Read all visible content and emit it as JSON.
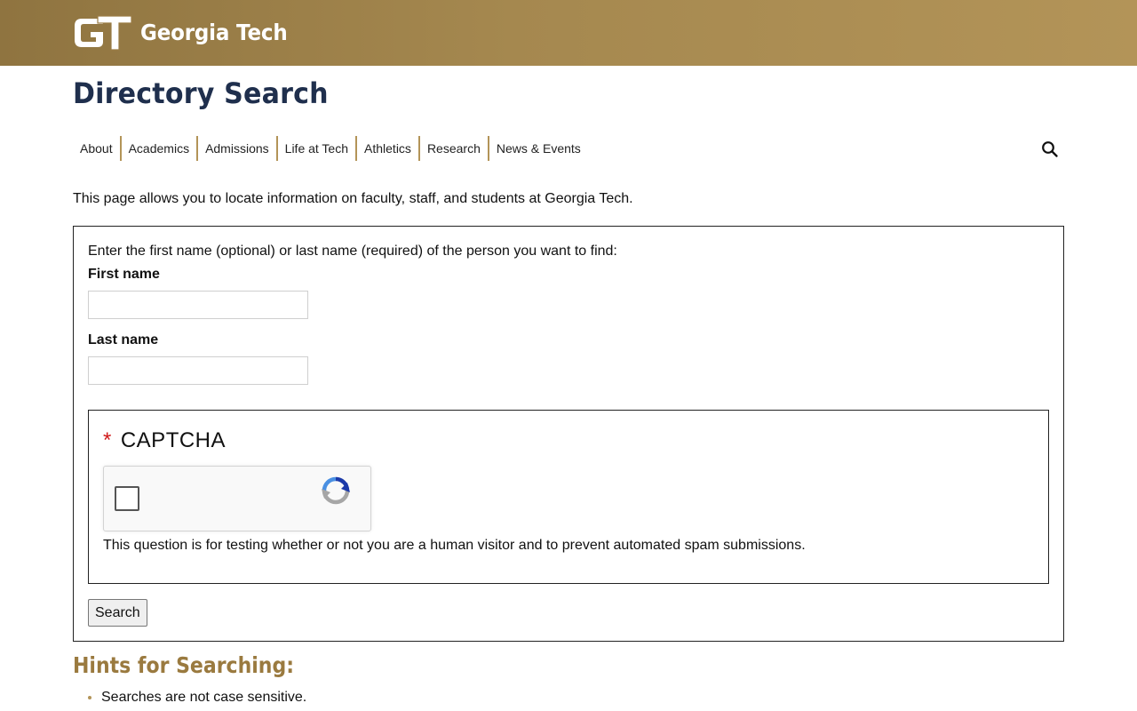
{
  "header": {
    "logo_text": "Georgia Tech",
    "logo_mark_letters": "GT",
    "colors": {
      "band_start": "#8f7440",
      "band_end": "#b39458"
    }
  },
  "page": {
    "title": "Directory Search",
    "title_color": "#1f2f4d"
  },
  "nav": {
    "items": [
      "About",
      "Academics",
      "Admissions",
      "Life at Tech",
      "Athletics",
      "Research",
      "News & Events"
    ],
    "search_icon": "search-icon",
    "separator_color": "#b39458"
  },
  "intro_text": "This page allows you to locate information on faculty, staff, and students at Georgia Tech.",
  "form": {
    "instructions": "Enter the first name (optional) or last name (required) of the person you want to find:",
    "first_name_label": "First name",
    "first_name_value": "",
    "last_name_label": "Last name",
    "last_name_value": "",
    "captcha": {
      "required_mark": "*",
      "title": "CAPTCHA",
      "description": "This question is for testing whether or not you are a human visitor and to prevent automated spam submissions.",
      "checked": false,
      "icon": "recaptcha-icon"
    },
    "submit_label": "Search"
  },
  "hints": {
    "title": "Hints for Searching:",
    "title_color": "#9a7a3f",
    "items": [
      "Searches are not case sensitive."
    ]
  }
}
